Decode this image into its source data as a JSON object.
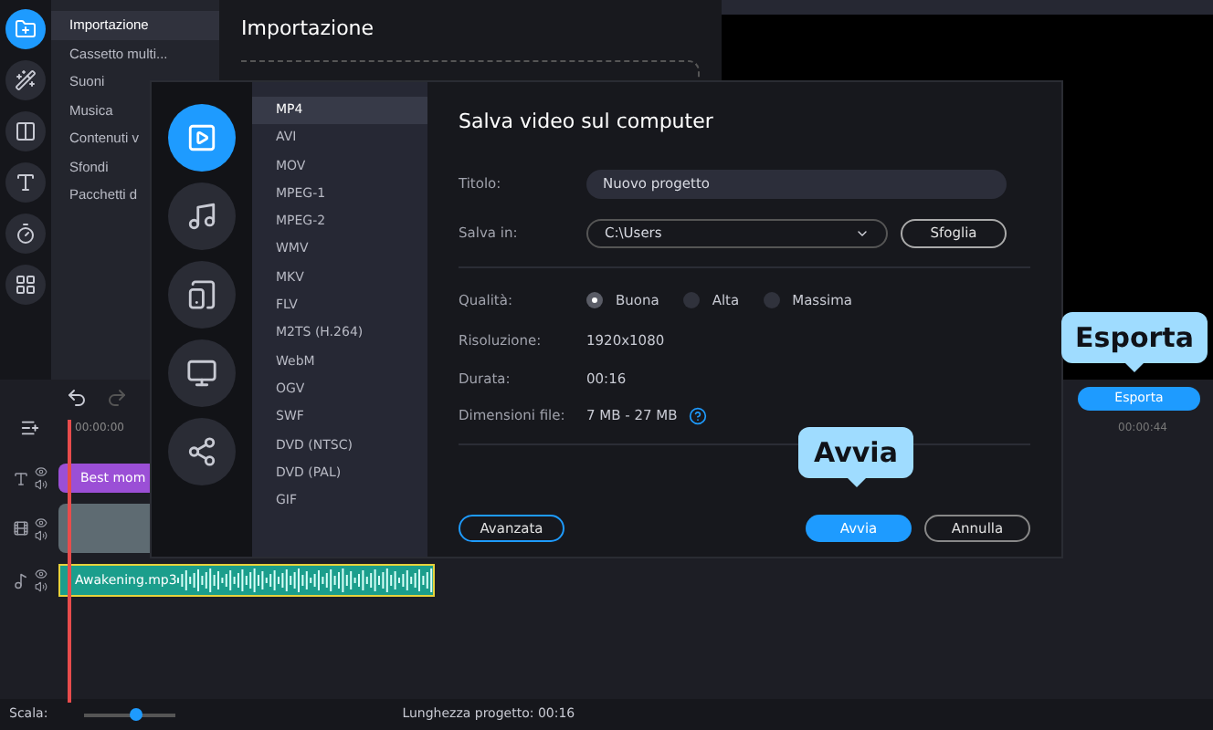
{
  "nav_rail": {
    "items": [
      {
        "kind": "import",
        "selected": true
      },
      {
        "kind": "effects",
        "selected": false
      },
      {
        "kind": "transitions",
        "selected": false
      },
      {
        "kind": "titles",
        "selected": false
      },
      {
        "kind": "stickers",
        "selected": false
      },
      {
        "kind": "more",
        "selected": false
      }
    ]
  },
  "sidebar": {
    "items": [
      {
        "label": "Importazione",
        "selected": true
      },
      {
        "label": "Cassetto multi...",
        "selected": false
      },
      {
        "label": "Suoni",
        "selected": false
      },
      {
        "label": "Musica",
        "selected": false
      },
      {
        "label": "Contenuti v",
        "selected": false
      },
      {
        "label": "Sfondi",
        "selected": false
      },
      {
        "label": "Pacchetti d",
        "selected": false
      }
    ]
  },
  "panel": {
    "title": "Importazione"
  },
  "timeline": {
    "export_button": "Esporta",
    "ruler": [
      "00:00:00",
      "00:00:44"
    ],
    "tracks": [
      {
        "kind": "title",
        "clip": "Best mom"
      },
      {
        "kind": "video"
      },
      {
        "kind": "audio",
        "clip": "Awakening.mp3"
      }
    ]
  },
  "status_bar": {
    "scale_label": "Scala:",
    "zoom": {
      "level": 0.55
    },
    "project_length": "Lunghezza progetto: 00:16"
  },
  "dialog": {
    "categories": [
      {
        "kind": "video",
        "selected": true
      },
      {
        "kind": "audio",
        "selected": false
      },
      {
        "kind": "devices",
        "selected": false
      },
      {
        "kind": "tv",
        "selected": false
      },
      {
        "kind": "share",
        "selected": false
      }
    ],
    "formats": [
      {
        "label": "MP4",
        "selected": true
      },
      {
        "label": "AVI",
        "selected": false
      },
      {
        "label": "MOV",
        "selected": false
      },
      {
        "label": "MPEG-1",
        "selected": false
      },
      {
        "label": "MPEG-2",
        "selected": false
      },
      {
        "label": "WMV",
        "selected": false
      },
      {
        "label": "MKV",
        "selected": false
      },
      {
        "label": "FLV",
        "selected": false
      },
      {
        "label": "M2TS (H.264)",
        "selected": false
      },
      {
        "label": "WebM",
        "selected": false
      },
      {
        "label": "OGV",
        "selected": false
      },
      {
        "label": "SWF",
        "selected": false
      },
      {
        "label": "DVD (NTSC)",
        "selected": false
      },
      {
        "label": "DVD (PAL)",
        "selected": false
      },
      {
        "label": "GIF",
        "selected": false
      }
    ],
    "title": "Salva video sul computer",
    "name_field": {
      "label": "Titolo:",
      "value": "Nuovo progetto"
    },
    "folder_field": {
      "label": "Salva in:",
      "value": "C:\\Users",
      "browse": "Sfoglia"
    },
    "quality": {
      "label": "Qualità:",
      "options": [
        {
          "label": "Buona",
          "selected": true
        },
        {
          "label": "Alta",
          "selected": false
        },
        {
          "label": "Massima",
          "selected": false
        }
      ]
    },
    "info": [
      {
        "label": "Risoluzione:",
        "value": "1920x1080"
      },
      {
        "label": "Durata:",
        "value": "00:16"
      },
      {
        "label": "Dimensioni file:",
        "value": "7 MB - 27 MB",
        "help": true
      }
    ],
    "buttons": {
      "advanced": "Avanzata",
      "start": "Avvia",
      "cancel": "Annulla"
    }
  },
  "tooltips": [
    {
      "text": "Avvia"
    },
    {
      "text": "Esporta"
    }
  ]
}
